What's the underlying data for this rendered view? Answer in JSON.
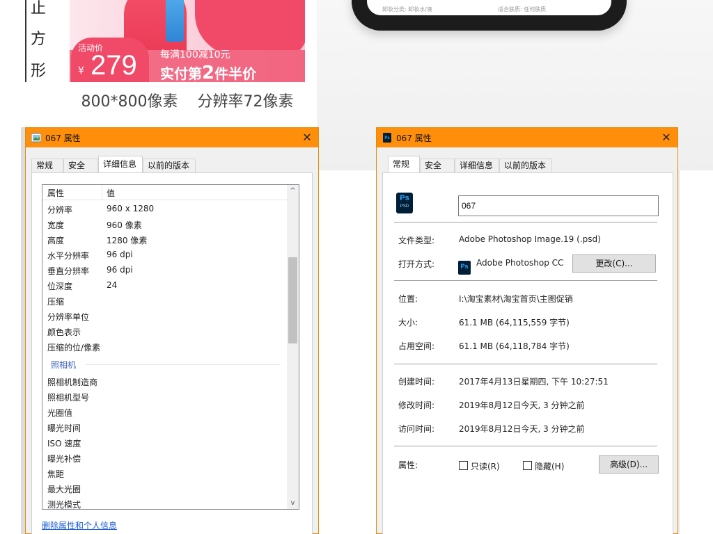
{
  "promo": {
    "vertical_chars": [
      "止",
      "方",
      "形"
    ],
    "activity_label": "活动价",
    "currency": "¥",
    "price": "279",
    "offer_line1": "每满100减10元",
    "offer_line2_prefix": "实付第",
    "offer_line2_number": "2",
    "offer_line2_suffix": "件半价",
    "caption": "800*800像素    分辨率72像素"
  },
  "phone": {
    "text_left": "卸妆分类: 卸妆水/液",
    "text_right": "适合肤质: 任何肤质"
  },
  "dialog_left": {
    "title": "067 属性",
    "close": "✕",
    "tabs": [
      "常规",
      "安全",
      "详细信息",
      "以前的版本"
    ],
    "active_tab": "详细信息",
    "columns": [
      "属性",
      "值"
    ],
    "rows": [
      {
        "k": "分辨率",
        "v": "960 x 1280"
      },
      {
        "k": "宽度",
        "v": "960 像素"
      },
      {
        "k": "高度",
        "v": "1280 像素"
      },
      {
        "k": "水平分辨率",
        "v": "96 dpi"
      },
      {
        "k": "垂直分辨率",
        "v": "96 dpi"
      },
      {
        "k": "位深度",
        "v": "24"
      },
      {
        "k": "压缩",
        "v": ""
      },
      {
        "k": "分辨率单位",
        "v": ""
      },
      {
        "k": "颜色表示",
        "v": ""
      },
      {
        "k": "压缩的位/像素",
        "v": ""
      }
    ],
    "group": "照相机",
    "camera_rows": [
      "照相机制造商",
      "照相机型号",
      "光圈值",
      "曝光时间",
      "ISO 速度",
      "曝光补偿",
      "焦距",
      "最大光圈",
      "测光模式"
    ],
    "scroll_up": "^",
    "scroll_down": "v",
    "link": "删除属性和个人信息"
  },
  "dialog_right": {
    "title": "067 属性",
    "close": "✕",
    "tabs": [
      "常规",
      "安全",
      "详细信息",
      "以前的版本"
    ],
    "active_tab": "常规",
    "icon_text": "Ps",
    "icon_sub": "PSD",
    "filename": "067",
    "file_type_label": "文件类型:",
    "file_type_value": "Adobe Photoshop Image.19 (.psd)",
    "open_with_label": "打开方式:",
    "open_with_value": "Adobe Photoshop CC",
    "change_button": "更改(C)...",
    "location_label": "位置:",
    "location_value": "I:\\淘宝素材\\淘宝首页\\主图促销",
    "size_label": "大小:",
    "size_value": "61.1 MB (64,115,559 字节)",
    "disk_size_label": "占用空间:",
    "disk_size_value": "61.1 MB (64,118,784 字节)",
    "created_label": "创建时间:",
    "created_value": "2017年4月13日星期四, 下午 10:27:51",
    "modified_label": "修改时间:",
    "modified_value": "2019年8月12日今天, 3 分钟之前",
    "accessed_label": "访问时间:",
    "accessed_value": "2019年8月12日今天, 3 分钟之前",
    "attributes_label": "属性:",
    "readonly_label": "只读(R)",
    "hidden_label": "隐藏(H)",
    "advanced_button": "高级(D)..."
  },
  "colors": {
    "titlebar": "#ff8f0a",
    "link": "#1a5cd6",
    "group_heading": "#3a5fbe"
  }
}
